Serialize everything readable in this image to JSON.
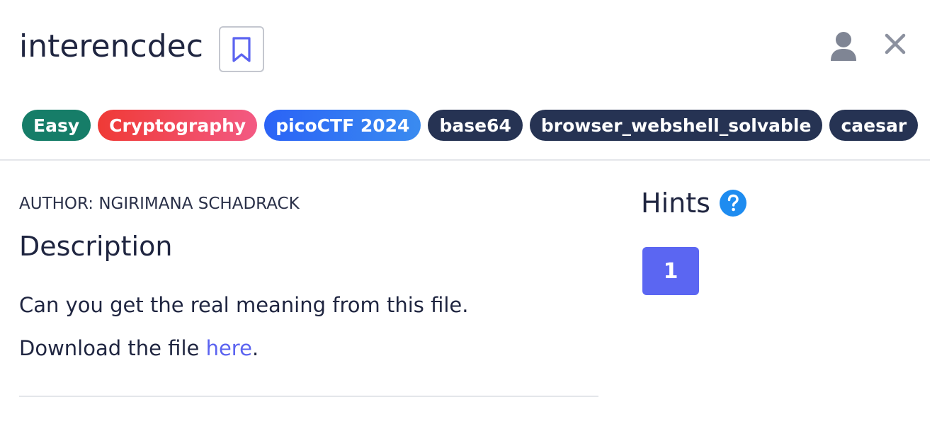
{
  "header": {
    "title": "interencdec"
  },
  "tags": {
    "easy": "Easy",
    "category": "Cryptography",
    "event": "picoCTF 2024",
    "t1": "base64",
    "t2": "browser_webshell_solvable",
    "t3": "caesar"
  },
  "body": {
    "author": "AUTHOR: NGIRIMANA SCHADRACK",
    "description_heading": "Description",
    "description_line1": "Can you get the real meaning from this file.",
    "description_line2_prefix": "Download the file ",
    "description_link": "here",
    "description_line2_suffix": "."
  },
  "hints": {
    "heading": "Hints",
    "buttons": [
      "1"
    ]
  },
  "icons": {
    "bookmark": "bookmark-icon",
    "user": "user-icon",
    "close": "close-icon",
    "help": "question-circle-icon"
  },
  "colors": {
    "accent": "#5b66f2",
    "easy": "#167d68",
    "cryptography": "#ef3a36",
    "picoctf": "#2b63f6",
    "tag_dark": "#263353",
    "link": "#5b63f0",
    "help_icon": "#1e8cf0"
  }
}
